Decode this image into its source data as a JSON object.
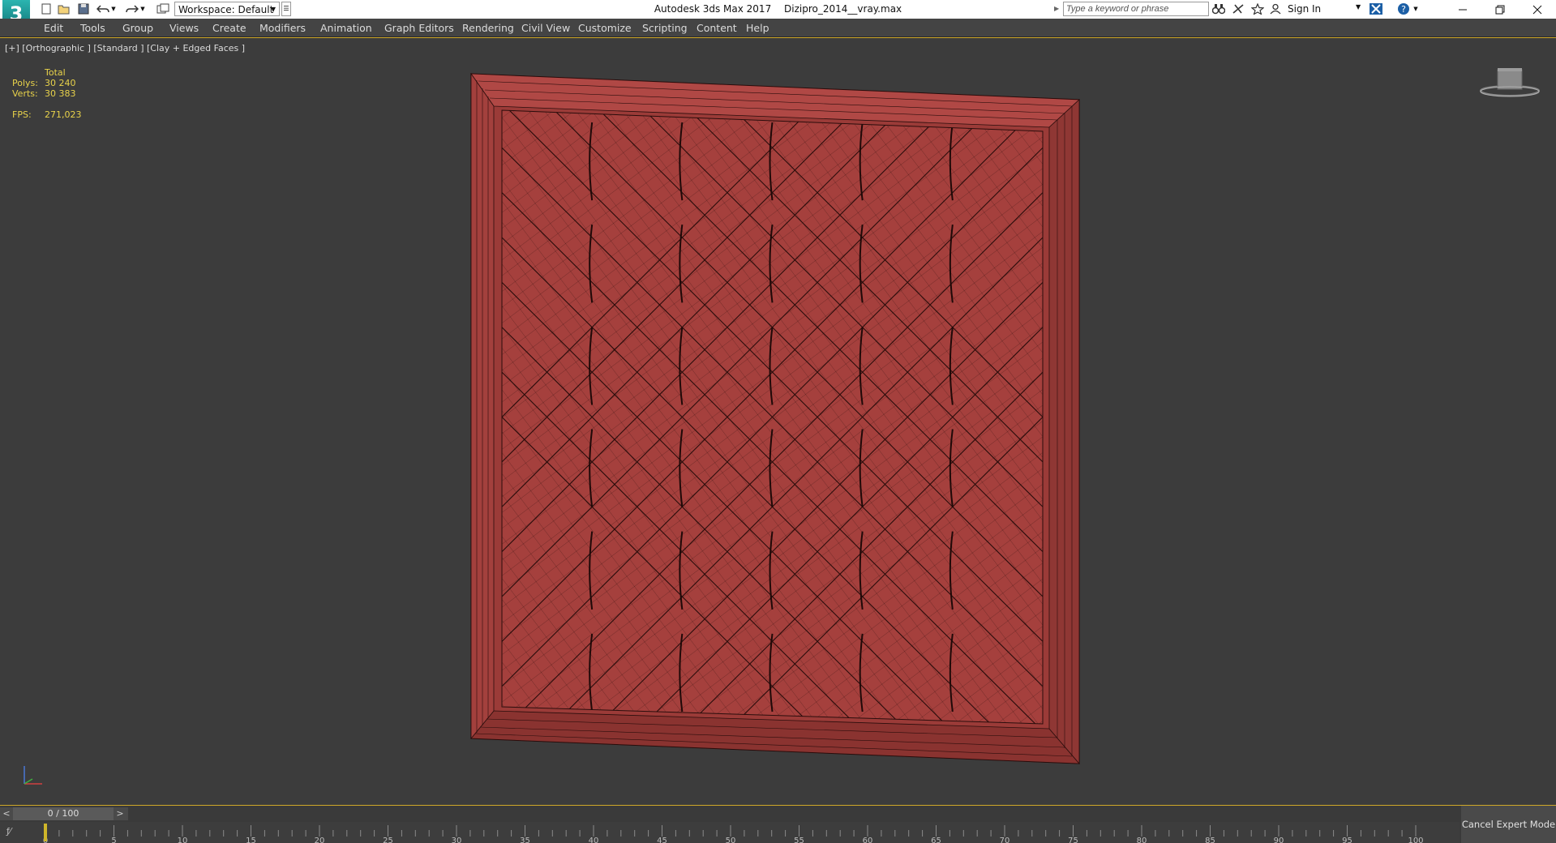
{
  "titlebar": {
    "app_logo": "3",
    "workspace": "Workspace: Default",
    "app_name": "Autodesk 3ds Max 2017",
    "file_name": "Dizipro_2014__vray.max",
    "search_placeholder": "Type a keyword or phrase",
    "sign_in": "Sign In"
  },
  "menu": [
    "Edit",
    "Tools",
    "Group",
    "Views",
    "Create",
    "Modifiers",
    "Animation",
    "Graph Editors",
    "Rendering",
    "Civil View",
    "Customize",
    "Scripting",
    "Content",
    "Help"
  ],
  "viewport": {
    "label": "[+] [Orthographic ] [Standard ] [Clay + Edged Faces ]",
    "stats": {
      "header": "Total",
      "polys_label": "Polys:",
      "polys_value": "30 240",
      "verts_label": "Verts:",
      "verts_value": "30 383",
      "fps_label": "FPS:",
      "fps_value": "271,023"
    },
    "viewcube_face": "front",
    "model_color": "#a5403d",
    "model_edge_color": "#2a0d0c"
  },
  "timeline": {
    "slider_text": "0 / 100",
    "prev": "<",
    "next": ">",
    "ticks": [
      "0",
      "5",
      "10",
      "15",
      "20",
      "25",
      "30",
      "35",
      "40",
      "45",
      "50",
      "55",
      "60",
      "65",
      "70",
      "75",
      "80",
      "85",
      "90",
      "95",
      "100"
    ],
    "current_frame": 0,
    "cancel_expert": "Cancel Expert Mode"
  }
}
